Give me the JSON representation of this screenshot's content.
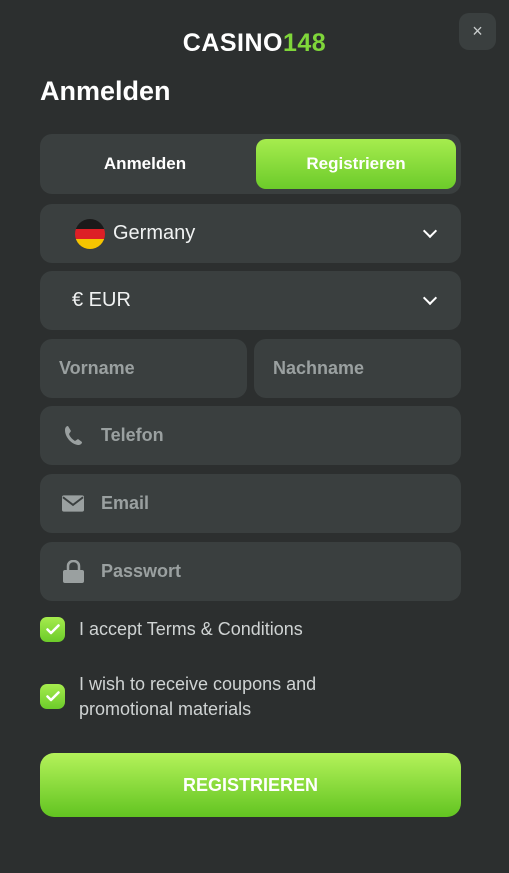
{
  "logo": {
    "part1": "CASINO",
    "part2": "148"
  },
  "close_icon": "×",
  "title": "Anmelden",
  "tabs": [
    {
      "label": "Anmelden",
      "active": false
    },
    {
      "label": "Registrieren",
      "active": true
    }
  ],
  "country": {
    "value": "Germany",
    "flag": "germany-flag-icon"
  },
  "currency": {
    "value": "€ EUR"
  },
  "first_name": {
    "placeholder": "Vorname"
  },
  "last_name": {
    "placeholder": "Nachname"
  },
  "phone": {
    "placeholder": "Telefon",
    "icon": "phone-icon"
  },
  "email": {
    "placeholder": "Email",
    "icon": "mail-icon"
  },
  "password": {
    "placeholder": "Passwort",
    "icon": "lock-icon"
  },
  "checkboxes": [
    {
      "line1": "I accept Terms & Conditions",
      "checked": true
    },
    {
      "line1": "I wish to receive coupons and",
      "line2": "promotional materials",
      "checked": true
    }
  ],
  "submit_label": "REGISTRIEREN",
  "colors": {
    "accent": "#7fd63a",
    "background": "#2c2f2f",
    "field": "#3a3f3f"
  }
}
